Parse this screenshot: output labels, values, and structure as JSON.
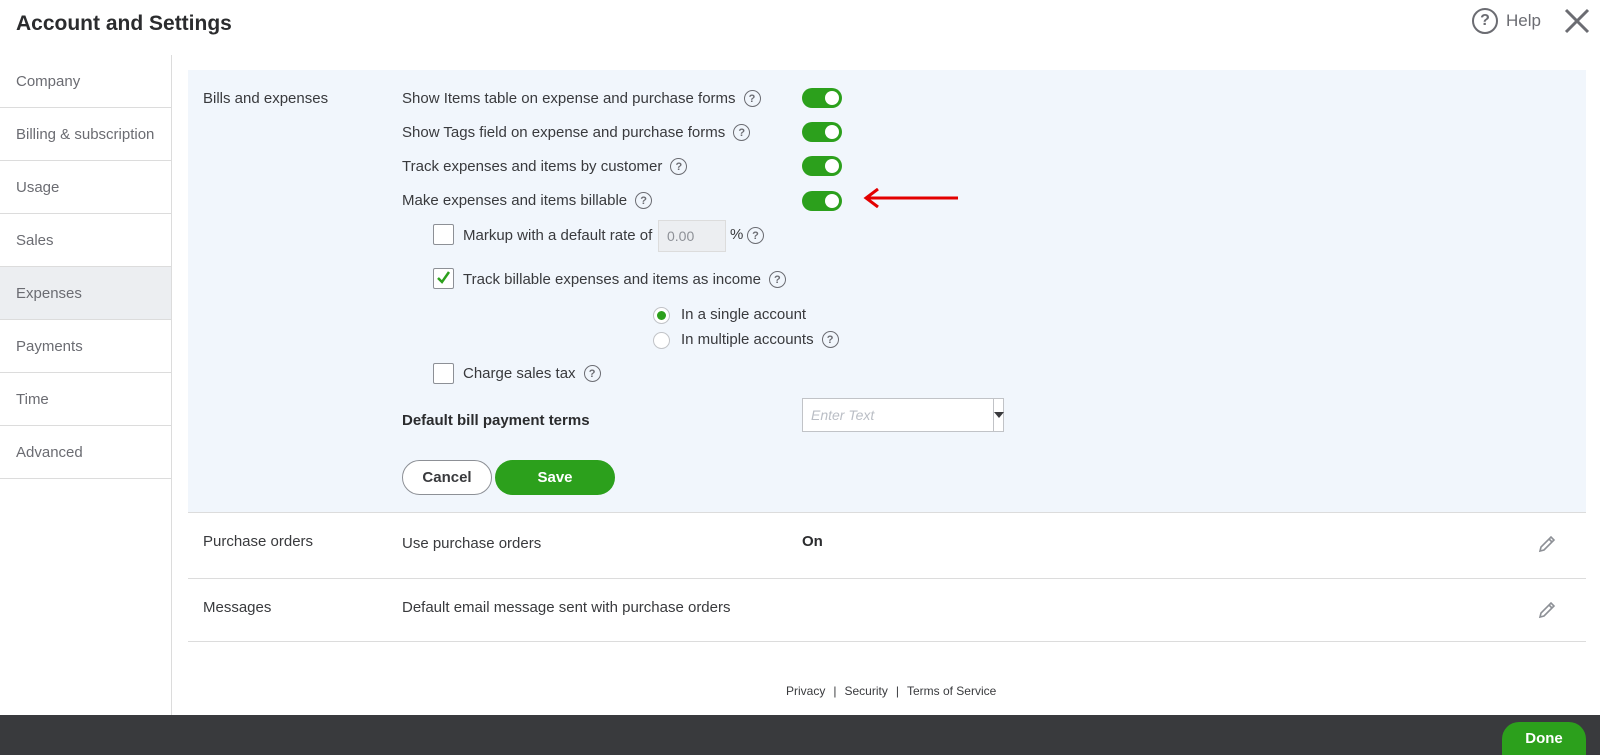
{
  "header": {
    "title": "Account and Settings",
    "help_label": "Help"
  },
  "sidebar": {
    "items": [
      {
        "label": "Company"
      },
      {
        "label": "Billing & subscription"
      },
      {
        "label": "Usage"
      },
      {
        "label": "Sales"
      },
      {
        "label": "Expenses",
        "active": true
      },
      {
        "label": "Payments"
      },
      {
        "label": "Time"
      },
      {
        "label": "Advanced"
      }
    ]
  },
  "bills": {
    "section_label": "Bills and expenses",
    "show_items_table": {
      "label": "Show Items table on expense and purchase forms",
      "on": true
    },
    "show_tags_field": {
      "label": "Show Tags field on expense and purchase forms",
      "on": true
    },
    "track_by_customer": {
      "label": "Track expenses and items by customer",
      "on": true
    },
    "make_billable": {
      "label": "Make expenses and items billable",
      "on": true
    },
    "markup": {
      "label": "Markup with a default rate of",
      "checked": false,
      "value": "0.00",
      "suffix": "%"
    },
    "track_as_income": {
      "label": "Track billable expenses and items as income",
      "checked": true
    },
    "single_account": {
      "label": "In a single account",
      "selected": true
    },
    "multiple_accounts": {
      "label": "In multiple accounts",
      "selected": false
    },
    "charge_sales_tax": {
      "label": "Charge sales tax",
      "checked": false
    },
    "default_terms": {
      "label": "Default bill payment terms",
      "placeholder": "Enter Text",
      "value": ""
    },
    "cancel_label": "Cancel",
    "save_label": "Save"
  },
  "purchase_orders": {
    "section_label": "Purchase orders",
    "description": "Use purchase orders",
    "status": "On"
  },
  "messages": {
    "section_label": "Messages",
    "description": "Default email message sent with purchase orders"
  },
  "footer": {
    "privacy": "Privacy",
    "security": "Security",
    "terms": "Terms of Service",
    "separator": "|"
  },
  "bottom_bar": {
    "done_label": "Done"
  },
  "colors": {
    "accent_green": "#2ca01c",
    "annotation_arrow": "#e30000",
    "section_bg": "#f1f6fc",
    "bottom_bar": "#393a3d"
  },
  "icons": {
    "help": "help-circle-icon",
    "close": "close-icon",
    "info": "question-circle-icon",
    "edit": "pencil-icon",
    "dropdown": "caret-down-icon",
    "arrow": "red-left-arrow-annotation"
  }
}
